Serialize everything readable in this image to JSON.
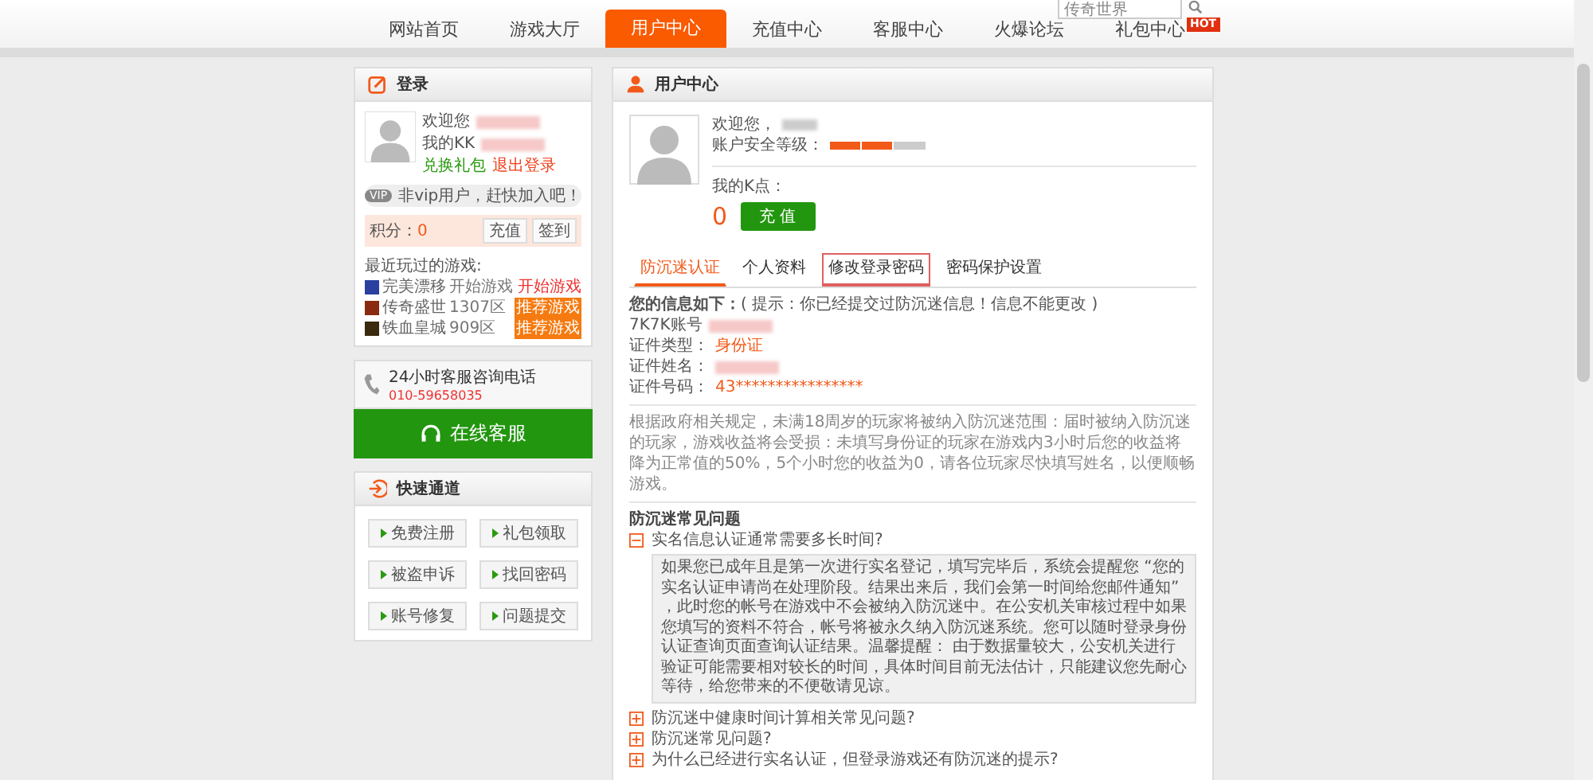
{
  "nav": {
    "items": [
      {
        "label": "网站首页",
        "selected": false
      },
      {
        "label": "游戏大厅",
        "selected": false
      },
      {
        "label": "用户中心",
        "selected": true
      },
      {
        "label": "充值中心",
        "selected": false
      },
      {
        "label": "客服中心",
        "selected": false
      },
      {
        "label": "火爆论坛",
        "selected": false
      },
      {
        "label": "礼包中心",
        "selected": false
      }
    ],
    "search": {
      "value": "传奇世界"
    },
    "hot_badge": "HOT"
  },
  "login": {
    "title": "登录",
    "welcome": "欢迎您",
    "my_kk": "我的KK",
    "gift_link": "兑换礼包",
    "logout_link": "退出登录",
    "vip_badge": "VIP",
    "vip_text": "非vip用户，赶快加入吧！",
    "points_label": "积分：",
    "points": "0",
    "recharge_button": "充值",
    "signin_button": "签到",
    "recent_title": "最近玩过的游戏:",
    "games": [
      {
        "name": "完美漂移",
        "zone": "开始游戏",
        "action": "开始游戏",
        "kind": "link",
        "color": "#2a3fa0"
      },
      {
        "name": "传奇盛世",
        "zone": "1307区",
        "action": "推荐游戏",
        "kind": "tag",
        "color": "#8a2a10"
      },
      {
        "name": "铁血皇城",
        "zone": "909区",
        "action": "推荐游戏",
        "kind": "tag",
        "color": "#3a2a10"
      }
    ]
  },
  "hotline": {
    "title": "24小时客服咨询电话",
    "phone": "010-59658035"
  },
  "online_service": {
    "label": "在线客服"
  },
  "quick": {
    "title": "快速通道",
    "links": [
      "免费注册",
      "礼包领取",
      "被盗申诉",
      "找回密码",
      "账号修复",
      "问题提交"
    ]
  },
  "user_center": {
    "title": "用户中心",
    "welcome": "欢迎您，",
    "security_label": "账户安全等级：",
    "security": {
      "level": 0.67
    },
    "k_label": "我的K点：",
    "k_points": "0",
    "recharge_button": "充 值",
    "tabs": [
      {
        "label": "防沉迷认证",
        "selected": true,
        "highlighted": false
      },
      {
        "label": "个人资料",
        "selected": false,
        "highlighted": false
      },
      {
        "label": "修改登录密码",
        "selected": false,
        "highlighted": true
      },
      {
        "label": "密码保护设置",
        "selected": false,
        "highlighted": false
      }
    ],
    "info_heading": "您的信息如下：",
    "info_hint": "( 提示：你已经提交过防沉迷信息！信息不能更改 )",
    "fields": [
      {
        "label": "7K7K账号",
        "kind": "redacted"
      },
      {
        "label": "证件类型：",
        "value": "身份证",
        "kind": "text"
      },
      {
        "label": "证件姓名：",
        "kind": "redacted"
      },
      {
        "label": "证件号码：",
        "value": "43****************",
        "kind": "text"
      }
    ],
    "notice": "根据政府相关规定，未满18周岁的玩家将被纳入防沉迷范围：届时被纳入防沉迷的玩家，游戏收益将会受损：未填写身份证的玩家在游戏内3小时后您的收益将降为正常值的50%，5个小时您的收益为0，请各位玩家尽快填写姓名，以便顺畅游戏。",
    "faq_title": "防沉迷常见问题",
    "faq": [
      {
        "question": "实名信息认证通常需要多长时间?",
        "expanded": true,
        "answer": "如果您已成年且是第一次进行实名登记，填写完毕后，系统会提醒您 “您的实名认证申请尚在处理阶段。结果出来后，我们会第一时间给您邮件通知” ，此时您的帐号在游戏中不会被纳入防沉迷中。在公安机关审核过程中如果您填写的资料不符合，帐号将被永久纳入防沉迷系统。您可以随时登录身份认证查询页面查询认证结果。温馨提醒： 由于数据量较大，公安机关进行验证可能需要相对较长的时间，具体时间目前无法估计，只能建议您先耐心等待，给您带来的不便敬请见谅。"
      },
      {
        "question": "防沉迷中健康时间计算相关常见问题?",
        "expanded": false
      },
      {
        "question": "防沉迷常见问题?",
        "expanded": false
      },
      {
        "question": "为什么已经进行实名认证，但登录游戏还有防沉迷的提示?",
        "expanded": false
      }
    ]
  }
}
